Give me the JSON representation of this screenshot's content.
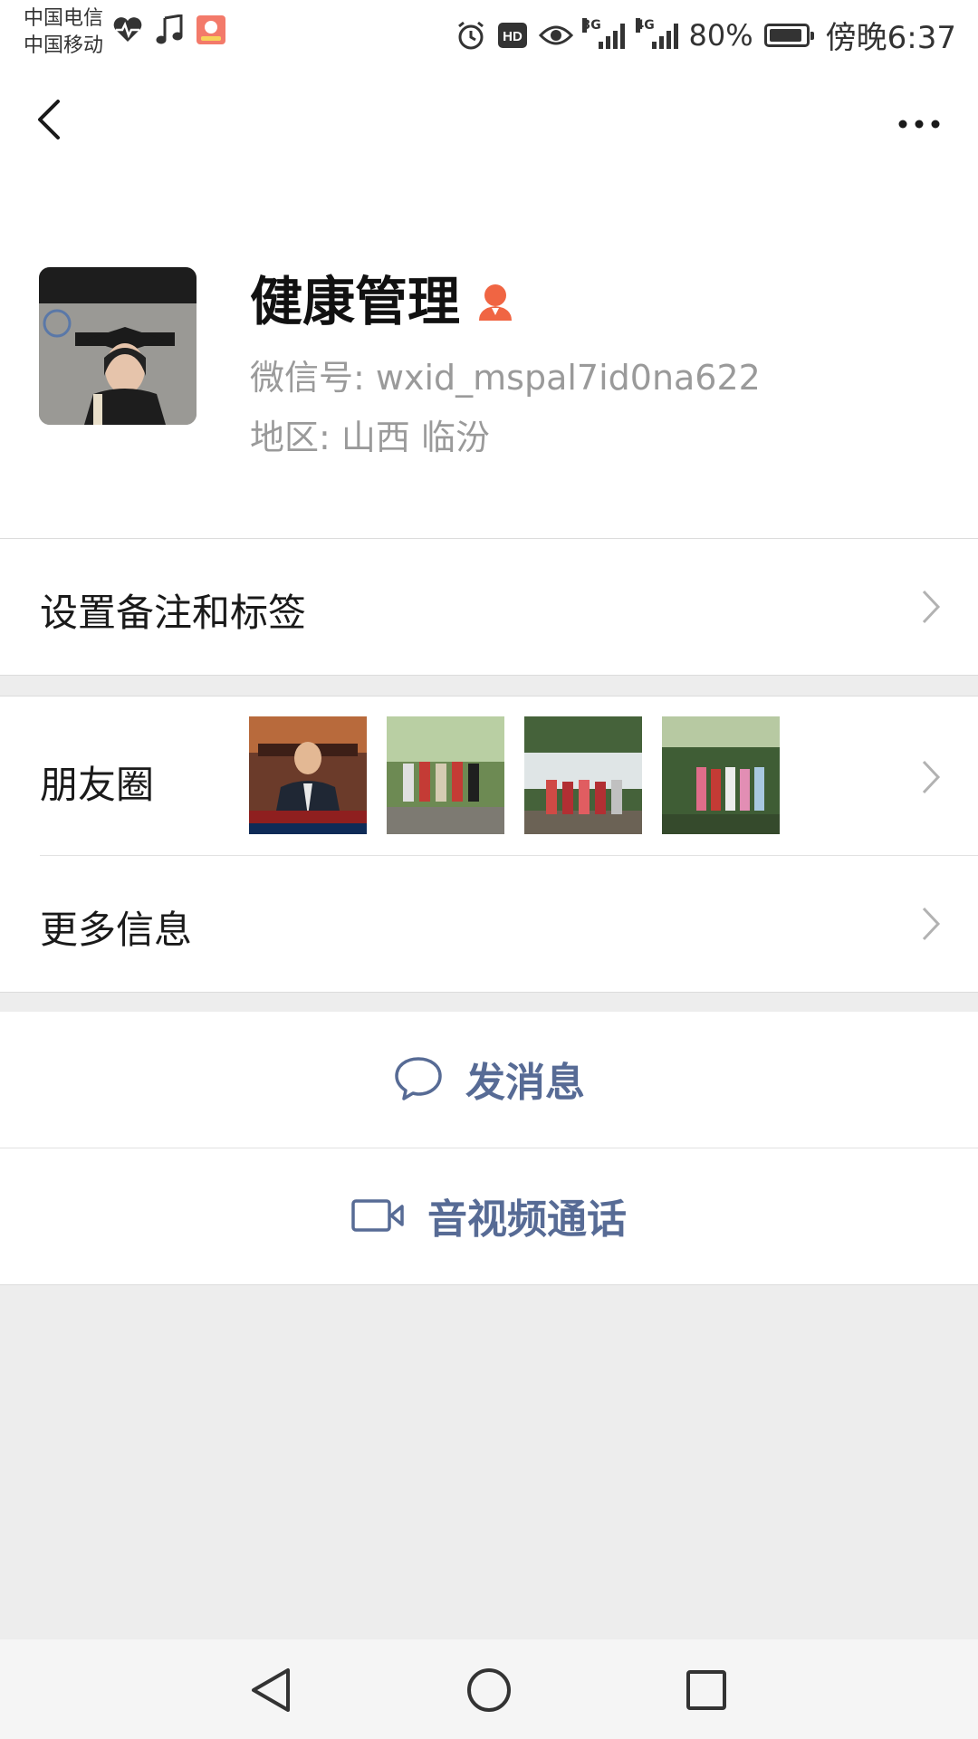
{
  "status_bar": {
    "carrier_1": "中国电信",
    "carrier_2": "中国移动",
    "network_3g": "3G",
    "network_4g": "4G",
    "battery": "80%",
    "time": "傍晚6:37"
  },
  "profile": {
    "name": "健康管理",
    "wechat_id": "微信号: wxid_mspal7id0na622",
    "region": "地区: 山西  临汾"
  },
  "rows": {
    "set_remark": "设置备注和标签",
    "moments": "朋友圈",
    "more_info": "更多信息"
  },
  "actions": {
    "send_message": "发消息",
    "video_call": "音视频通话"
  },
  "colors": {
    "link_blue": "#576b95",
    "gender_icon": "#f06543",
    "background": "#ededed"
  },
  "icons": [
    "back-icon",
    "more-icon",
    "gender-female-icon",
    "chevron-right-icon",
    "chat-bubble-icon",
    "video-camera-icon",
    "nav-back-icon",
    "nav-home-icon",
    "nav-recents-icon"
  ]
}
